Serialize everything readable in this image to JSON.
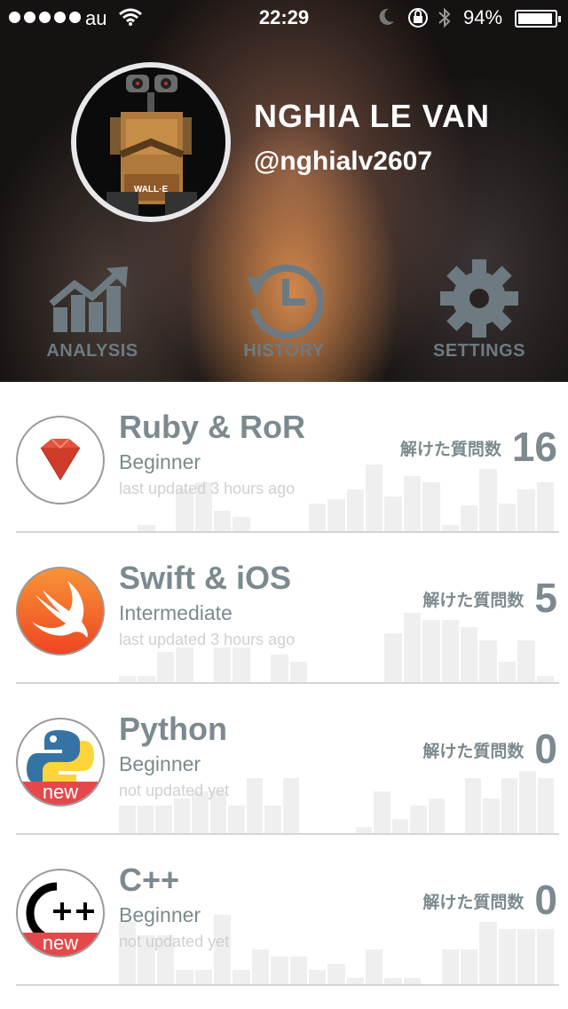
{
  "status_bar": {
    "carrier": "au",
    "time": "22:29",
    "battery_percent": "94%",
    "battery_level": 0.94,
    "icons": [
      "signal-dots-icon",
      "wifi-icon",
      "moon-icon",
      "rotation-lock-icon",
      "bluetooth-icon",
      "battery-icon"
    ]
  },
  "profile": {
    "name": "NGHIA LE VAN",
    "handle": "@nghialv2607",
    "avatar_caption": "WALL·E"
  },
  "tabs": [
    {
      "label": "ANALYSIS",
      "icon": "growth-chart-icon"
    },
    {
      "label": "HISTORY",
      "icon": "history-clock-icon"
    },
    {
      "label": "SETTINGS",
      "icon": "gear-icon"
    }
  ],
  "count_label": "解けた質問数",
  "courses": [
    {
      "title": "Ruby & RoR",
      "level": "Beginner",
      "updated": "last updated 3 hours ago",
      "count": "16",
      "icon": "ruby-gem-icon",
      "is_new": false,
      "bars": [
        0,
        5,
        0,
        36,
        42,
        18,
        12,
        0,
        0,
        0,
        24,
        28,
        36,
        58,
        30,
        48,
        42,
        5,
        22,
        54,
        24,
        36,
        42
      ]
    },
    {
      "title": "Swift & iOS",
      "level": "Intermediate",
      "updated": "last updated 3 hours ago",
      "count": "5",
      "icon": "swift-bird-icon",
      "is_new": false,
      "bars": [
        5,
        5,
        26,
        30,
        0,
        30,
        30,
        0,
        24,
        18,
        0,
        0,
        0,
        0,
        42,
        60,
        54,
        54,
        48,
        36,
        18,
        36,
        5
      ]
    },
    {
      "title": "Python",
      "level": "Beginner",
      "updated": "not updated yet",
      "count": "0",
      "icon": "python-logo-icon",
      "is_new": true,
      "new_label": "new",
      "bars": [
        24,
        24,
        24,
        30,
        36,
        36,
        24,
        48,
        24,
        48,
        0,
        0,
        0,
        5,
        36,
        12,
        24,
        30,
        0,
        48,
        30,
        48,
        54,
        48
      ]
    },
    {
      "title": "C++",
      "level": "Beginner",
      "updated": "not updated yet",
      "count": "0",
      "icon": "cpp-logo-icon",
      "is_new": true,
      "new_label": "new",
      "bars": [
        54,
        42,
        42,
        12,
        12,
        60,
        12,
        30,
        24,
        24,
        12,
        18,
        5,
        30,
        5,
        5,
        0,
        30,
        30,
        54,
        48,
        48,
        48
      ]
    }
  ]
}
